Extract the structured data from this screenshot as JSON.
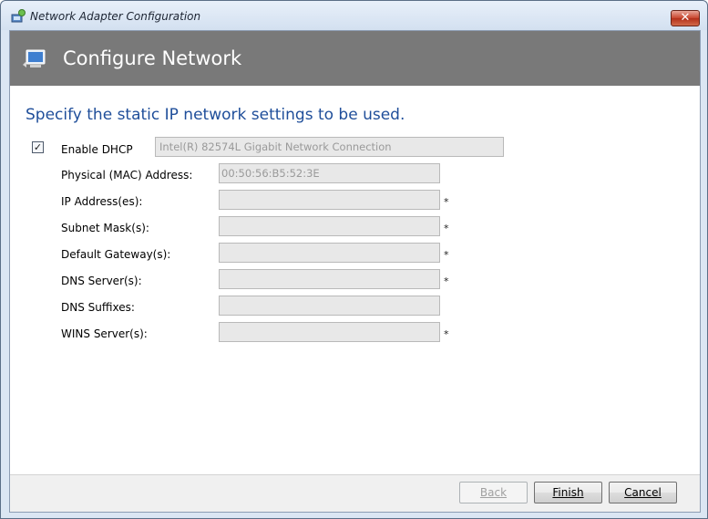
{
  "window": {
    "title": "Network Adapter Configuration",
    "close_glyph": "✕"
  },
  "header": {
    "title": "Configure Network",
    "icon": "network-monitor-icon"
  },
  "main": {
    "subtitle": "Specify the static IP network settings to be used.",
    "dhcp": {
      "label": "Enable DHCP",
      "checked": true,
      "check_glyph": "✓"
    },
    "adapter_name": "Intel(R) 82574L Gigabit Network Connection",
    "fields": [
      {
        "label": "Physical (MAC) Address:",
        "value": "00:50:56:B5:52:3E",
        "required": false
      },
      {
        "label": "IP Address(es):",
        "value": "",
        "required": true
      },
      {
        "label": "Subnet Mask(s):",
        "value": "",
        "required": true
      },
      {
        "label": "Default Gateway(s):",
        "value": "",
        "required": true
      },
      {
        "label": "DNS Server(s):",
        "value": "",
        "required": true
      },
      {
        "label": "DNS Suffixes:",
        "value": "",
        "required": false
      },
      {
        "label": "WINS Server(s):",
        "value": "",
        "required": true
      }
    ],
    "required_marker": "*"
  },
  "footer": {
    "back": {
      "label": "Back",
      "enabled": false
    },
    "finish": {
      "label": "Finish",
      "enabled": true
    },
    "cancel": {
      "label": "Cancel",
      "enabled": true
    }
  },
  "colors": {
    "header_band": "#797979",
    "subtitle": "#1f4e9a",
    "close_button": "#c7442c"
  }
}
